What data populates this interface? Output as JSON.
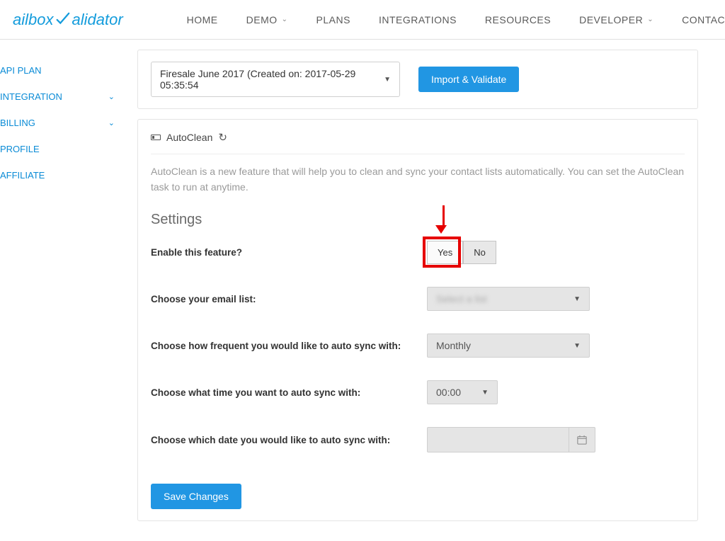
{
  "logo": {
    "prefix": "ailbox",
    "suffix": "alidator"
  },
  "nav": [
    "HOME",
    "DEMO",
    "PLANS",
    "INTEGRATIONS",
    "RESOURCES",
    "DEVELOPER",
    "CONTACT"
  ],
  "sidebar": [
    "API PLAN",
    "INTEGRATION",
    "BILLING",
    "PROFILE",
    "AFFILIATE"
  ],
  "listSelect": {
    "value": "Firesale June 2017 (Created on: 2017-05-29 05:35:54"
  },
  "importBtn": "Import & Validate",
  "autoclean": {
    "title": "AutoClean",
    "desc": "AutoClean is a new feature that will help you to clean and sync your contact lists automatically. You can set the AutoClean task to run at anytime.",
    "settingsTitle": "Settings",
    "rows": {
      "enable": "Enable this feature?",
      "list": "Choose your email list:",
      "freq": "Choose how frequent you would like to auto sync with:",
      "time": "Choose what time you want to auto sync with:",
      "date": "Choose which date you would like to auto sync with:"
    },
    "toggle": {
      "yes": "Yes",
      "no": "No"
    },
    "freqValue": "Monthly",
    "timeValue": "00:00",
    "saveBtn": "Save Changes"
  }
}
